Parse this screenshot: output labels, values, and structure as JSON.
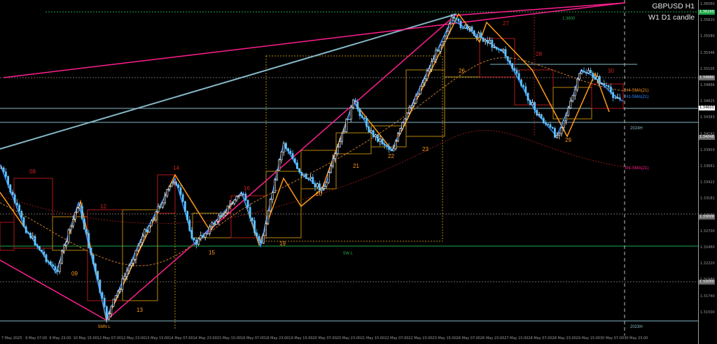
{
  "header": {
    "symbol": "GBPUSD H1",
    "candle_mode": "W1 D1 candle"
  },
  "price_axis": {
    "labels": [
      "1.36060",
      "1.35820",
      "1.35580",
      "1.35346",
      "1.35105",
      "1.34866",
      "1.34625",
      "1.34383",
      "1.34142",
      "1.33903",
      "1.33661",
      "1.33422",
      "1.33181",
      "1.32940",
      "1.32700",
      "1.32460",
      "1.32220",
      "1.31980",
      "1.31740",
      "1.31500"
    ],
    "current_price": "1.34603",
    "marker_1": "1.36160",
    "marker_2": "1.34880",
    "marker_3": "1.34046",
    "marker_4": "1.33009",
    "marker_5": "1.32000"
  },
  "time_axis": {
    "labels": [
      "7 May 2025",
      "9 May 07:00",
      "9 May 23:00",
      "10 May 15:00",
      "12 May 07:00",
      "12 May 23:00",
      "13 May 15:00",
      "14 May 07:00",
      "14 May 23:00",
      "15 May 15:00",
      "16 May 07:00",
      "16 May 23:00",
      "19 May 15:00",
      "20 May 07:00",
      "20 May 23:00",
      "21 May 15:00",
      "22 May 07:00",
      "22 May 23:00",
      "23 May 15:00",
      "26 May 07:00",
      "26 May 23:00",
      "27 May 15:00",
      "28 May 07:00",
      "28 May 23:00",
      "29 May 15:00",
      "30 May 07:00",
      "30 May 23:00"
    ]
  },
  "annotations": {
    "top_level": "1.3600",
    "sw_low": "5W L",
    "smn_low": "5MN L",
    "y2024_high": "2024H",
    "y2023_high": "2023H",
    "h4_sma": "H4-SMA(21)",
    "h1_sma": "H1-SMA(21)",
    "d1_sma": "D1-SMA(21)",
    "day_numbers_red": [
      "08",
      "12",
      "14",
      "16",
      "27",
      "28",
      "30"
    ],
    "day_numbers_orange": [
      "09",
      "13",
      "15",
      "19",
      "20",
      "21",
      "22",
      "23",
      "26",
      "29"
    ]
  },
  "colors": {
    "background": "#000000",
    "pink_trend": "#ff1f8f",
    "light_blue_trend": "#86b8c8",
    "green_level": "#1ea84a",
    "orange_zigzag": "#ff9a1a",
    "blue_zigzag": "#2f8cff",
    "red_box": "#b01818",
    "gold_box": "#b8860b",
    "candle_bull": "#ffffff",
    "candle_bear": "#5fc4ff"
  }
}
